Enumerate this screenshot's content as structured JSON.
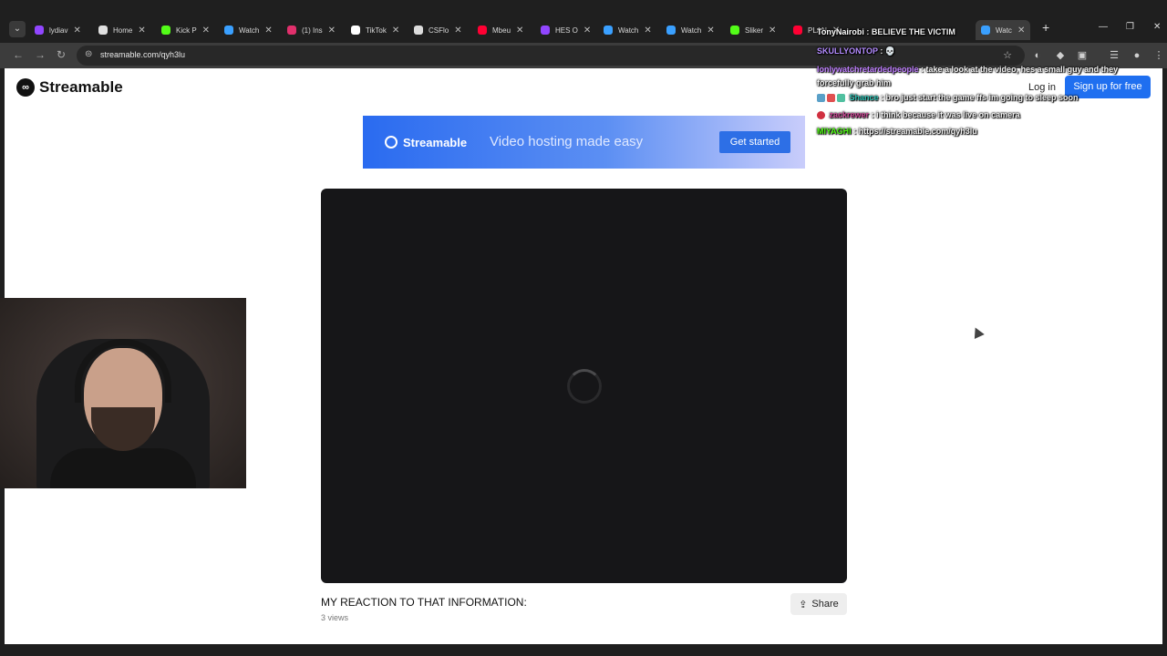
{
  "browser": {
    "tabs": [
      {
        "label": "lydiav",
        "color": "#9146ff"
      },
      {
        "label": "Home",
        "color": "#e0e0e0"
      },
      {
        "label": "Kick P",
        "color": "#53fc18"
      },
      {
        "label": "Watch",
        "color": "#3aa0ff"
      },
      {
        "label": "(1) Ins",
        "color": "#e1306c"
      },
      {
        "label": "TikTok",
        "color": "#ffffff"
      },
      {
        "label": "CSFlo",
        "color": "#dddddd"
      },
      {
        "label": "Mbeu",
        "color": "#ff0033"
      },
      {
        "label": "HES O",
        "color": "#9146ff"
      },
      {
        "label": "Watch",
        "color": "#3aa0ff"
      },
      {
        "label": "Watch",
        "color": "#3aa0ff"
      },
      {
        "label": "Sliker",
        "color": "#53fc18"
      },
      {
        "label": "PLAN",
        "color": "#ff0033"
      },
      {
        "label": "Watc",
        "color": "#3aa0ff"
      }
    ],
    "url": "streamable.com/qyh3lu"
  },
  "page": {
    "logo": "Streamable",
    "login": "Log in",
    "signup": "Sign up for free",
    "ad": {
      "brand": "Streamable",
      "tagline": "Video hosting made easy",
      "button": "Get started"
    },
    "video": {
      "title": "MY REACTION TO THAT INFORMATION:",
      "views": "3 views",
      "share": "Share"
    }
  },
  "chat": [
    {
      "user": "TonyNairobi",
      "user_color": "#ffffff",
      "msg": "BELIEVE THE VICTIM"
    },
    {
      "user": "SKULLYONTOP",
      "user_color": "#b48cff",
      "msg": "💀"
    },
    {
      "user": "lonlywatchretardedpeople",
      "user_color": "#c080ff",
      "msg": "take a look at the video, hes a small guy and they forcefully grab him"
    },
    {
      "user": "Shance",
      "user_color": "#2ec4b6",
      "msg": "bro just start the game ffs im going to sleep soon"
    },
    {
      "user": "zackrewer",
      "user_color": "#d04a9a",
      "msg": "i think because it was live on camera"
    },
    {
      "user": "MIYAGHI",
      "user_color": "#53fc18",
      "msg": "https://streamable.com/qyh3lu"
    }
  ]
}
